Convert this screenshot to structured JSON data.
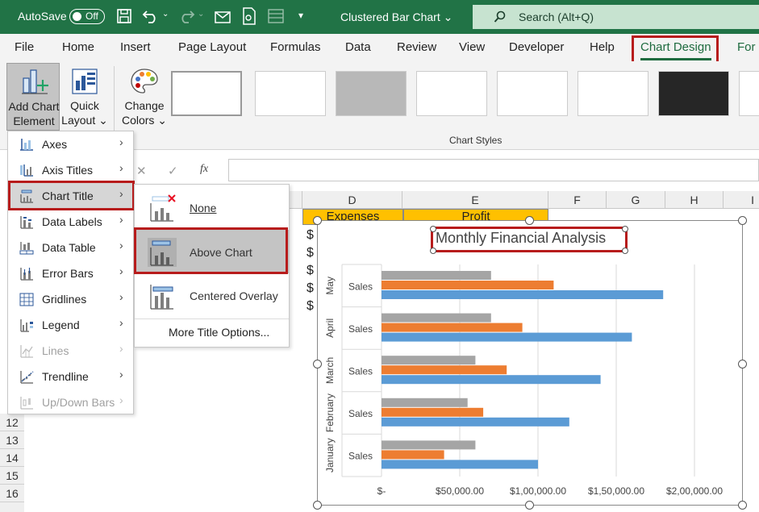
{
  "titlebar": {
    "autosave_label": "AutoSave",
    "autosave_state": "Off",
    "doc_title": "Clustered Bar Chart ⌄",
    "search_placeholder": "Search (Alt+Q)",
    "bg_color": "#217346"
  },
  "ribbon_tabs": [
    "File",
    "Home",
    "Insert",
    "Page Layout",
    "Formulas",
    "Data",
    "Review",
    "View",
    "Developer",
    "Help",
    "Chart Design",
    "For"
  ],
  "ribbon": {
    "add_chart_element": [
      "Add Chart",
      "Element ⌄"
    ],
    "quick_layout": [
      "Quick",
      "Layout ⌄"
    ],
    "change_colors": [
      "Change",
      "Colors ⌄"
    ],
    "group_label": "Chart Styles"
  },
  "formula_bar": {
    "cancel": "✕",
    "enter": "✓",
    "fx": "fx"
  },
  "columns": [
    "D",
    "E",
    "F",
    "G",
    "H",
    "I"
  ],
  "rows": [
    "12",
    "13",
    "14",
    "15",
    "16"
  ],
  "table_headers": [
    "Expenses",
    "Profit"
  ],
  "dollar_sign": "$",
  "menu": {
    "items": [
      {
        "label": "Axes",
        "enabled": true,
        "icon": "axes-icon"
      },
      {
        "label": "Axis Titles",
        "enabled": true,
        "icon": "axis-titles-icon"
      },
      {
        "label": "Chart Title",
        "enabled": true,
        "icon": "chart-title-icon"
      },
      {
        "label": "Data Labels",
        "enabled": true,
        "icon": "data-labels-icon"
      },
      {
        "label": "Data Table",
        "enabled": true,
        "icon": "data-table-icon"
      },
      {
        "label": "Error Bars",
        "enabled": true,
        "icon": "error-bars-icon"
      },
      {
        "label": "Gridlines",
        "enabled": true,
        "icon": "gridlines-icon"
      },
      {
        "label": "Legend",
        "enabled": true,
        "icon": "legend-icon"
      },
      {
        "label": "Lines",
        "enabled": false,
        "icon": "lines-icon"
      },
      {
        "label": "Trendline",
        "enabled": true,
        "icon": "trendline-icon"
      },
      {
        "label": "Up/Down Bars",
        "enabled": false,
        "icon": "up-down-bars-icon"
      }
    ]
  },
  "submenu": {
    "items": [
      {
        "label": "None"
      },
      {
        "label": "Above Chart"
      },
      {
        "label": "Centered Overlay"
      }
    ],
    "more": "More Title Options..."
  },
  "chart_data": {
    "type": "bar",
    "title": "Monthly Financial Analysis",
    "categories": [
      "January",
      "February",
      "March",
      "April",
      "May"
    ],
    "sub_label": "Sales",
    "series": [
      {
        "values": [
          100000,
          120000,
          140000,
          160000,
          180000
        ],
        "color": "#5b9bd5"
      },
      {
        "values": [
          40000,
          65000,
          80000,
          90000,
          110000
        ],
        "color": "#ed7d31"
      },
      {
        "values": [
          60000,
          55000,
          60000,
          70000,
          70000
        ],
        "color": "#a5a5a5"
      }
    ],
    "x_ticks": [
      "$-",
      "$50,000.00",
      "$1,00,000.00",
      "$1,50,000.00",
      "$2,00,000.00"
    ],
    "xlim": [
      0,
      200000
    ],
    "grid": true
  }
}
